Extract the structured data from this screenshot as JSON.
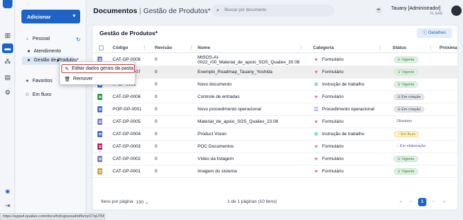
{
  "rail": {
    "icons": [
      "dashboard-icon",
      "folder-icon",
      "network-icon",
      "document-icon",
      "settings-icon",
      "collapse-icon"
    ]
  },
  "side": {
    "add_button": "Adicionar",
    "items": [
      {
        "label": "Pessoal",
        "icon": "home-icon"
      },
      {
        "label": "Atendimento",
        "icon": "folder-icon"
      },
      {
        "label": "Gestão de Produtos*",
        "icon": "folder-icon"
      },
      {
        "label": "Favoritos",
        "icon": "star-icon"
      },
      {
        "label": "Em fluxo",
        "icon": "flow-icon"
      }
    ]
  },
  "header": {
    "title": "Documentos",
    "subtitle": "Gestão de Produtos*",
    "search_placeholder": "Buscar por documento",
    "user_name": "Tauany [Administrador]",
    "user_sub": "FL EAD"
  },
  "main": {
    "card_title": "Gestão de Produtos*",
    "details_label": "Detalhes",
    "columns": [
      "Código",
      "Revisão",
      "Nome",
      "Categoria",
      "Status",
      "Próxima"
    ],
    "rows": [
      {
        "code": "CAT-GP-0008",
        "rev": "0",
        "name": "MtSOS-AI-0022_r00_Material_de_apoio_SOS_Qualiex_30.08",
        "cat": "Formulário",
        "cat_icon": "heart-icon",
        "status": "Vigente",
        "status_style": "green",
        "file_color": "#7b7fc4"
      },
      {
        "code": "CAT-GP-0007",
        "rev": "0",
        "name": "Exemplo_Roadmap_Tauany_Yoshida",
        "cat": "Formulário",
        "cat_icon": "heart-icon",
        "status": "Vigente",
        "status_style": "green",
        "file_color": "#7b7fc4"
      },
      {
        "code": "IT-GP-0001",
        "rev": "0",
        "name": "Novo documento",
        "cat": "Instrução de trabalho",
        "cat_icon": "gear-icon",
        "status": "Vigente",
        "status_style": "green",
        "file_color": "#3b6fd0"
      },
      {
        "code": "CAT-GP-0006",
        "rev": "0",
        "name": "Controle de entradas",
        "cat": "Formulário",
        "cat_icon": "heart-icon",
        "status": "Em criação",
        "status_style": "gray",
        "file_color": "#2e9a4c"
      },
      {
        "code": "POP-GP-0001",
        "rev": "0",
        "name": "Novo procedimento operacional",
        "cat": "Procedimento operacional",
        "cat_icon": "list-icon",
        "status": "Em criação",
        "status_style": "gray",
        "file_color": "#3b6fd0"
      },
      {
        "code": "CAT-GP-0005",
        "rev": "0",
        "name": "Material_de_apoio_SOS_Qualiex_23.08",
        "cat": "Formulário",
        "cat_icon": "heart-icon",
        "status": "Obsoleto",
        "status_style": "plain",
        "file_color": "#7b7fc4"
      },
      {
        "code": "CAT-GP-0004",
        "rev": "0",
        "name": "Product Vision",
        "cat": "Instrução de trabalho",
        "cat_icon": "gear-icon",
        "status": "Em fluxo",
        "status_style": "yellow",
        "file_color": "#3b6fd0"
      },
      {
        "code": "CAT-GP-0003",
        "rev": "0",
        "name": "POC Documentos",
        "cat": "Formulário",
        "cat_icon": "heart-icon",
        "status": "Em elaboração",
        "status_style": "blue",
        "file_color": "#c2185b"
      },
      {
        "code": "CAT-GP-0002",
        "rev": "0",
        "name": "Vídeo da listagem",
        "cat": "Formulário",
        "cat_icon": "heart-icon",
        "status": "Vigente",
        "status_style": "green",
        "file_color": "#7b7fc4"
      },
      {
        "code": "CAT-GP-0001",
        "rev": "0",
        "name": "Imagem do sistema",
        "cat": "Formulário",
        "cat_icon": "heart-icon",
        "status": "Vigente",
        "status_style": "green",
        "file_color": "#c8a23a"
      }
    ]
  },
  "footer": {
    "per_page_label": "Itens por página",
    "per_page_value": "100",
    "page_info": "1 de 1 páginas (10 itens)",
    "current_page": "1"
  },
  "context_menu": {
    "items": [
      {
        "label": "Editar dados gerais da pasta",
        "icon": "pencil-icon"
      },
      {
        "label": "Remover",
        "icon": "trash-icon"
      }
    ]
  },
  "statusbar": {
    "url": "https://apps4.qualiex.com/docs/fo/logicexad/d/fo/oyO7qUTM"
  },
  "colors": {
    "accent": "#1d64c6",
    "heart": "#e0788f",
    "gear": "#2bb3a3",
    "list": "#5b6fd6"
  }
}
